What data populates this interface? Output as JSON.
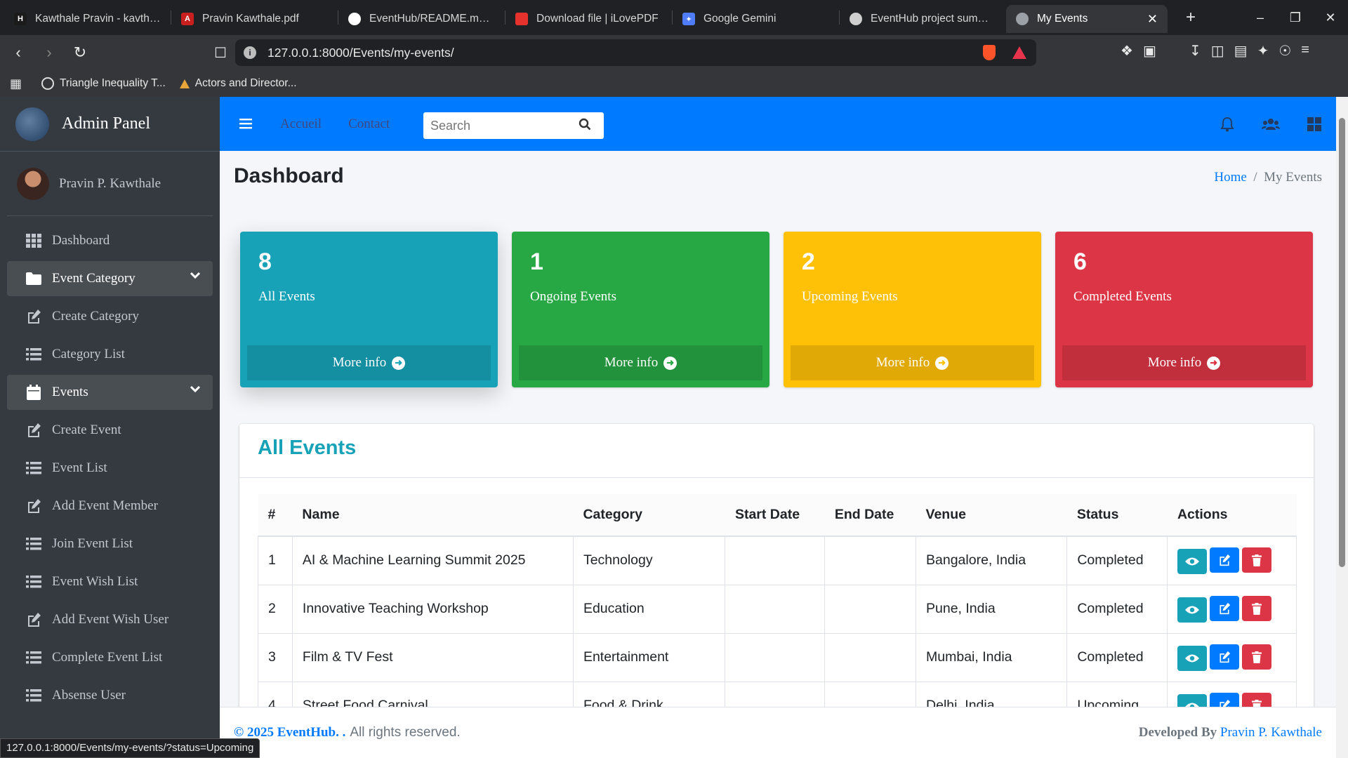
{
  "browser": {
    "tabs": [
      {
        "title": "Kawthale Pravin - kavthale",
        "favicon_color": "#1b1b1b",
        "favicon_text": "H"
      },
      {
        "title": "Pravin Kawthale.pdf",
        "favicon_color": "#c91f1f",
        "favicon_text": "A"
      },
      {
        "title": "EventHub/README.md at",
        "favicon_color": "#ffffff",
        "favicon_text": ""
      },
      {
        "title": "Download file | iLovePDF",
        "favicon_color": "#e5322d",
        "favicon_text": ""
      },
      {
        "title": "Google Gemini",
        "favicon_color": "#4f7cf7",
        "favicon_text": "✦"
      },
      {
        "title": "EventHub project summar",
        "favicon_color": "#cfcfcf",
        "favicon_text": ""
      },
      {
        "title": "My Events",
        "favicon_color": "#9aa0a6",
        "favicon_text": ""
      }
    ],
    "url": "127.0.0.1:8000/Events/my-events/",
    "bookmarks": [
      "Triangle Inequality T...",
      "Actors and Director..."
    ],
    "status_url": "127.0.0.1:8000/Events/my-events/?status=Upcoming"
  },
  "sidebar": {
    "brand": "Admin Panel",
    "user": "Pravin P. Kawthale",
    "items": [
      {
        "label": "Dashboard",
        "icon": "grid-icon",
        "open": false
      },
      {
        "label": "Event Category",
        "icon": "folder-icon",
        "open": true
      },
      {
        "label": "Create Category",
        "icon": "edit-icon",
        "open": false
      },
      {
        "label": "Category List",
        "icon": "list-icon",
        "open": false
      },
      {
        "label": "Events",
        "icon": "calendar-icon",
        "open": true
      },
      {
        "label": "Create Event",
        "icon": "edit-icon",
        "open": false
      },
      {
        "label": "Event List",
        "icon": "list-icon",
        "open": false
      },
      {
        "label": "Add Event Member",
        "icon": "edit-icon",
        "open": false
      },
      {
        "label": "Join Event List",
        "icon": "list-icon",
        "open": false
      },
      {
        "label": "Event Wish List",
        "icon": "list-icon",
        "open": false
      },
      {
        "label": "Add Event Wish User",
        "icon": "edit-icon",
        "open": false
      },
      {
        "label": "Complete Event List",
        "icon": "list-icon",
        "open": false
      },
      {
        "label": "Absense User",
        "icon": "list-icon",
        "open": false
      }
    ]
  },
  "topnav": {
    "links": [
      "Accueil",
      "Contact"
    ],
    "search_placeholder": "Search"
  },
  "content": {
    "title": "Dashboard",
    "breadcrumb": {
      "home": "Home",
      "current": "My Events"
    },
    "stats": [
      {
        "count": "8",
        "label": "All Events",
        "more": "More info",
        "color": "#17a2b8"
      },
      {
        "count": "1",
        "label": "Ongoing Events",
        "more": "More info",
        "color": "#28a745"
      },
      {
        "count": "2",
        "label": "Upcoming Events",
        "more": "More info",
        "color": "#ffc107"
      },
      {
        "count": "6",
        "label": "Completed Events",
        "more": "More info",
        "color": "#dc3545"
      }
    ],
    "table": {
      "title": "All Events",
      "headers": [
        "#",
        "Name",
        "Category",
        "Start Date",
        "End Date",
        "Venue",
        "Status",
        "Actions"
      ],
      "rows": [
        {
          "n": "1",
          "name": "AI & Machine Learning Summit 2025",
          "category": "Technology",
          "start": "",
          "end": "",
          "venue": "Bangalore, India",
          "status": "Completed"
        },
        {
          "n": "2",
          "name": "Innovative Teaching Workshop",
          "category": "Education",
          "start": "",
          "end": "",
          "venue": "Pune, India",
          "status": "Completed"
        },
        {
          "n": "3",
          "name": "Film & TV Fest",
          "category": "Entertainment",
          "start": "",
          "end": "",
          "venue": "Mumbai, India",
          "status": "Completed"
        },
        {
          "n": "4",
          "name": "Street Food Carnival",
          "category": "Food & Drink",
          "start": "",
          "end": "",
          "venue": "Delhi, India",
          "status": "Upcoming"
        }
      ]
    }
  },
  "footer": {
    "copyright": "© 2025 EventHub. .",
    "rights": "All rights reserved.",
    "developed_by": "Developed By",
    "developer": "Pravin P. Kawthale"
  }
}
